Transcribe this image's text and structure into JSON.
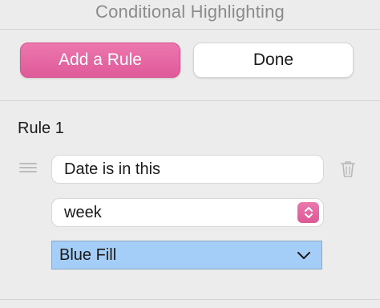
{
  "header": {
    "title": "Conditional Highlighting"
  },
  "toolbar": {
    "add_label": "Add a Rule",
    "done_label": "Done"
  },
  "rule": {
    "title": "Rule 1",
    "condition_text": "Date is in this",
    "period_value": "week",
    "style_value": "Blue Fill"
  },
  "colors": {
    "accent": "#e56aa4",
    "style_fill": "#a4cdf7",
    "background": "#ececec"
  },
  "icons": [
    "drag-handle-icon",
    "trash-icon",
    "stepper-icon",
    "chevron-down-icon"
  ]
}
